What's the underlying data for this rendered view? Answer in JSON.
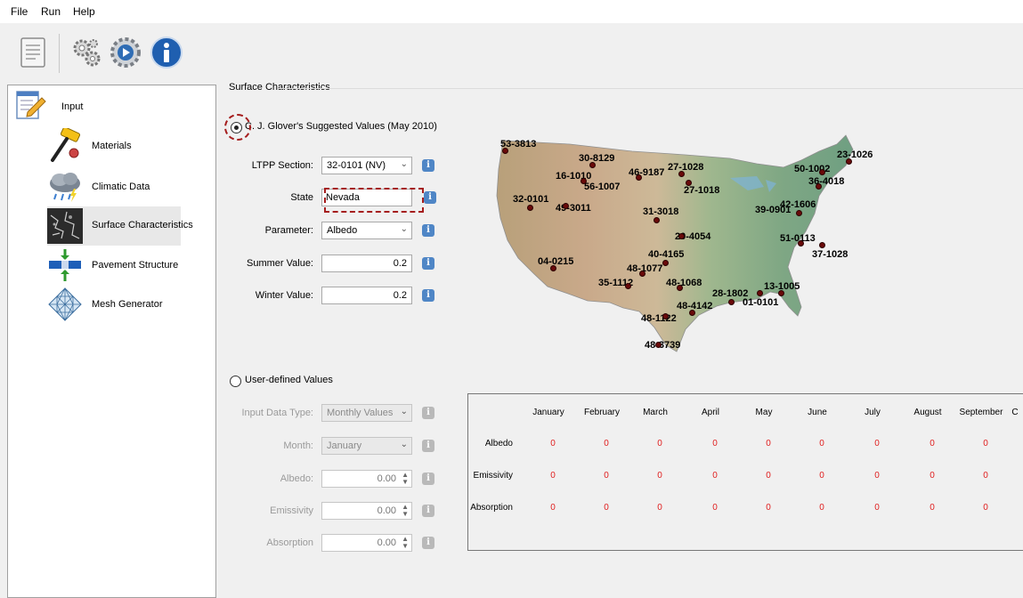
{
  "menu": {
    "file": "File",
    "run": "Run",
    "help": "Help"
  },
  "toolbar": {
    "buttons": [
      "document-icon",
      "gears-icon",
      "run-gear-icon",
      "info-icon"
    ]
  },
  "tree": {
    "root": "Input",
    "items": [
      "Materials",
      "Climatic Data",
      "Surface Characteristics",
      "Pavement Structure",
      "Mesh Generator"
    ],
    "selected": "Surface Characteristics"
  },
  "group": {
    "title": "Surface Characteristics"
  },
  "suggested": {
    "radio_label": "C. J. Glover's Suggested Values (May 2010)",
    "ltpp_label": "LTPP Section:",
    "ltpp_value": "32-0101 (NV)",
    "state_label": "State",
    "state_value": "Nevada",
    "param_label": "Parameter:",
    "param_value": "Albedo",
    "summer_label": "Summer Value:",
    "summer_value": "0.2",
    "winter_label": "Winter Value:",
    "winter_value": "0.2"
  },
  "map": {
    "stations": [
      {
        "label": "53-3813"
      },
      {
        "label": "30-8129"
      },
      {
        "label": "16-1010"
      },
      {
        "label": "56-1007"
      },
      {
        "label": "46-9187"
      },
      {
        "label": "27-1028"
      },
      {
        "label": "27-1018"
      },
      {
        "label": "32-0101"
      },
      {
        "label": "49-3011"
      },
      {
        "label": "31-3018"
      },
      {
        "label": "20-4054"
      },
      {
        "label": "40-4165"
      },
      {
        "label": "04-0215"
      },
      {
        "label": "48-1077"
      },
      {
        "label": "35-1112"
      },
      {
        "label": "48-1068"
      },
      {
        "label": "28-1802"
      },
      {
        "label": "13-1005"
      },
      {
        "label": "01-0101"
      },
      {
        "label": "48-4142"
      },
      {
        "label": "48-1122"
      },
      {
        "label": "48-3739"
      },
      {
        "label": "50-1002"
      },
      {
        "label": "23-1026"
      },
      {
        "label": "36-4018"
      },
      {
        "label": "42-1606"
      },
      {
        "label": "39-0901"
      },
      {
        "label": "51-0113"
      },
      {
        "label": "37-1028"
      }
    ]
  },
  "user": {
    "radio_label": "User-defined Values",
    "input_type_label": "Input Data Type:",
    "input_type_value": "Monthly Values",
    "month_label": "Month:",
    "month_value": "January",
    "albedo_label": "Albedo:",
    "albedo_value": "0.00",
    "emissivity_label": "Emissivity",
    "emissivity_value": "0.00",
    "absorption_label": "Absorption",
    "absorption_value": "0.00"
  },
  "table": {
    "months": [
      "January",
      "February",
      "March",
      "April",
      "May",
      "June",
      "July",
      "August",
      "September",
      "C"
    ],
    "rows": [
      {
        "name": "Albedo",
        "values": [
          "0",
          "0",
          "0",
          "0",
          "0",
          "0",
          "0",
          "0",
          "0"
        ]
      },
      {
        "name": "Emissivity",
        "values": [
          "0",
          "0",
          "0",
          "0",
          "0",
          "0",
          "0",
          "0",
          "0"
        ]
      },
      {
        "name": "Absorption",
        "values": [
          "0",
          "0",
          "0",
          "0",
          "0",
          "0",
          "0",
          "0",
          "0"
        ]
      }
    ]
  },
  "info_glyph": "i",
  "colors": {
    "value_red": "#e02020",
    "highlight_dash": "#a51d1d",
    "info_blue": "#4f86c6"
  }
}
